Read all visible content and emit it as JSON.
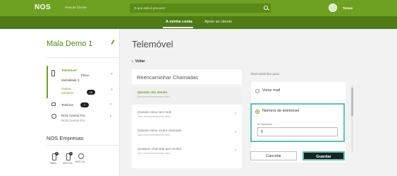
{
  "header": {
    "logo": "NOS",
    "area": "Área de Cliente",
    "search_placeholder": "O que está à procura?",
    "user": "Tomas"
  },
  "subnav": {
    "items": [
      "A minha conta",
      "Apoio ao cliente"
    ],
    "active": "A minha conta"
  },
  "sidebar": {
    "account_title": "Mala Demo 1",
    "items": [
      {
        "label": "Telemóvel",
        "detail": "Plano",
        "sub": "Mobilidade 2"
      },
      {
        "label": "Outros números",
        "badge": "19"
      },
      {
        "label": "Telefone",
        "badge": "7"
      },
      {
        "label": "NOS Central Pro",
        "sub": "NOS Central Pro"
      }
    ],
    "section_title": "NOS Empresas",
    "bottom_items": [
      {
        "label": "Telefo...",
        "count": "8"
      },
      {
        "label": "NOS Ce...",
        "count": "9"
      },
      {
        "label": "NOS Ce...",
        "count": ""
      }
    ]
  },
  "main": {
    "title": "Telemóvel",
    "back": "Voltar",
    "panel_title": "Reencaminhar Chamadas",
    "options": [
      {
        "title": "Quando não atende",
        "sub": "Sem reencaminhamento ativo",
        "selected": true
      },
      {
        "title": "Quando estou sem rede",
        "sub": "Sem reencaminhamento ativo",
        "selected": false
      },
      {
        "title": "Quando estou noutra chamada",
        "sub": "Sem reencaminhamento ativo",
        "selected": false
      },
      {
        "title": "Qualquer chamada que receba",
        "sub": "Sem reencaminhamento ativo",
        "selected": false
      }
    ],
    "right_header": "Reencaminhar para:",
    "choices": [
      {
        "label": "Voice mail",
        "checked": false
      },
      {
        "label": "Número de telemóvel",
        "checked": true
      }
    ],
    "field_label": "Nº Telemóvel",
    "field_value": "9",
    "cancel_label": "Cancelar",
    "save_label": "Guardar"
  },
  "colors": {
    "brand_green": "#6fa121",
    "dark_green": "#4d7c16",
    "highlight": "#5cc3b5"
  }
}
